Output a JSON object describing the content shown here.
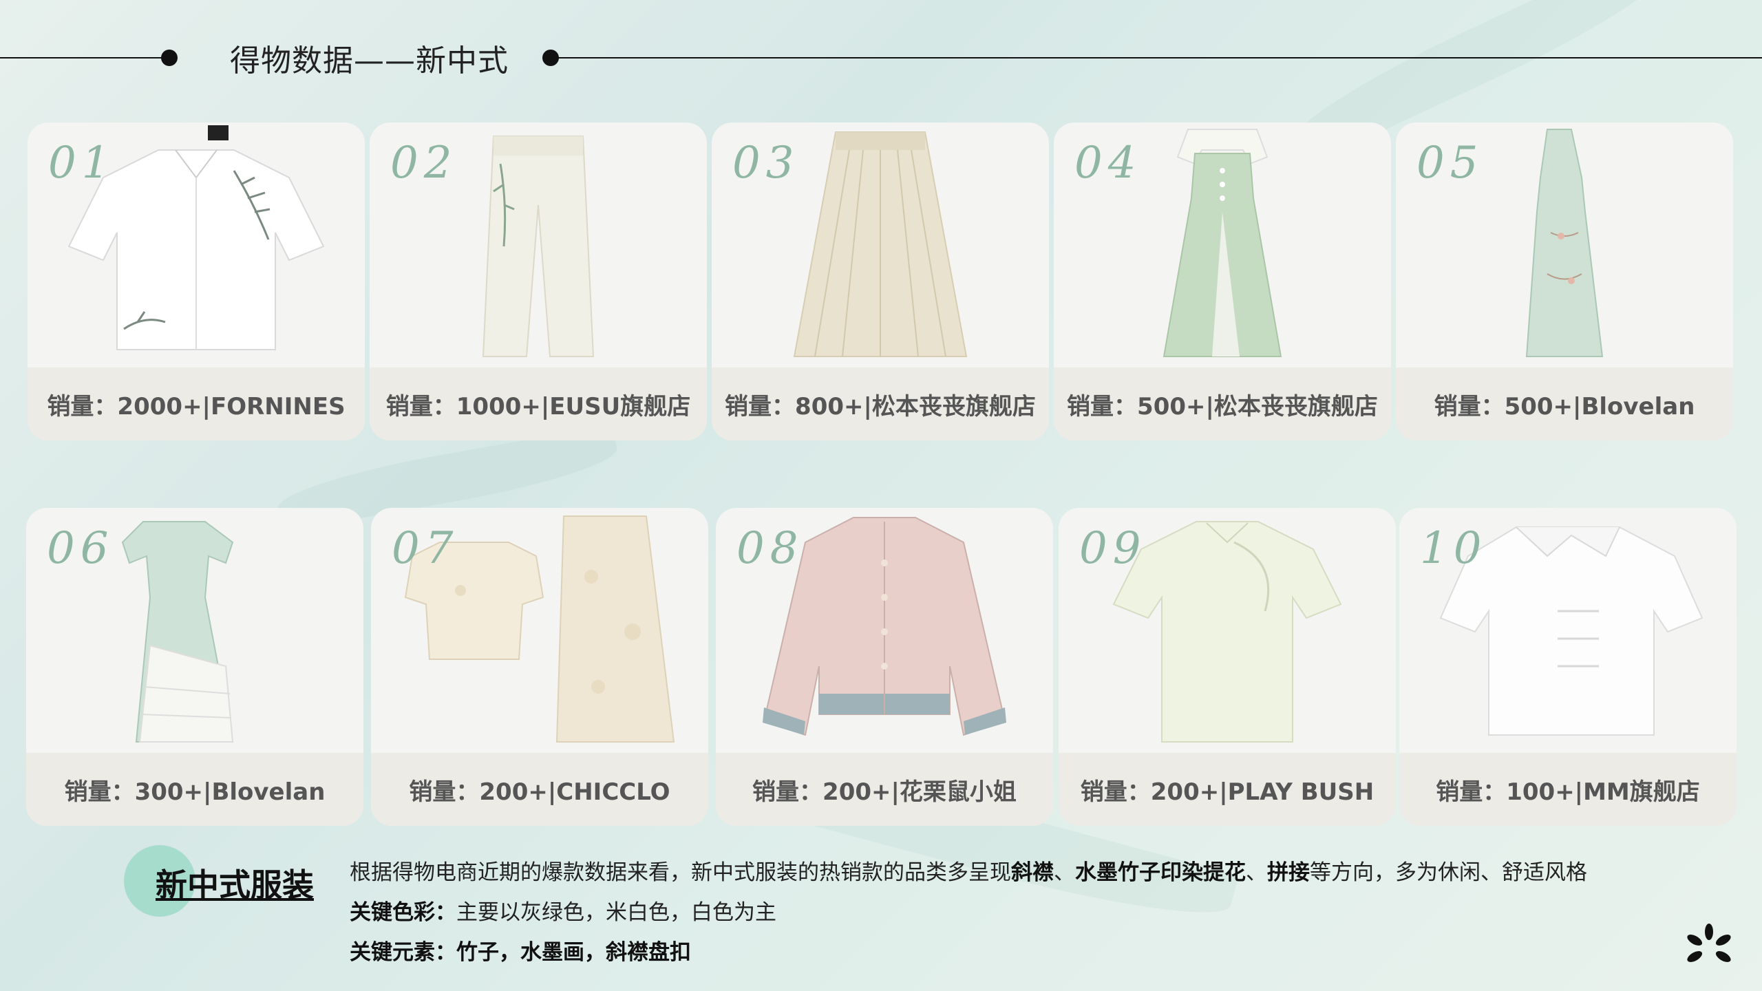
{
  "header": {
    "title": "得物数据——新中式"
  },
  "cards": [
    {
      "num": "01",
      "label": "销量：2000+|FORNINES"
    },
    {
      "num": "02",
      "label": "销量：1000+|EUSU旗舰店"
    },
    {
      "num": "03",
      "label": "销量：800+|松本丧丧旗舰店"
    },
    {
      "num": "04",
      "label": "销量：500+|松本丧丧旗舰店"
    },
    {
      "num": "05",
      "label": "销量：500+|Blovelan"
    },
    {
      "num": "06",
      "label": "销量：300+|Blovelan"
    },
    {
      "num": "07",
      "label": "销量：200+|CHICCLO"
    },
    {
      "num": "08",
      "label": "销量：200+|花栗鼠小姐"
    },
    {
      "num": "09",
      "label": "销量：200+|PLAY BUSH"
    },
    {
      "num": "10",
      "label": "销量：100+|MM旗舰店"
    }
  ],
  "summary": {
    "badge": "新中式服装",
    "line1": {
      "prefix": "根据得物电商近期的爆款数据来看，新中式服装的热销款的品类多呈现",
      "b1": "斜襟",
      "sep1": "、",
      "b2": "水墨竹子印染提花",
      "sep2": "、",
      "b3": "拼接",
      "suffix": "等方向，多为休闲、舒适风格"
    },
    "line2": {
      "label": "关键色彩：",
      "text": "主要以灰绿色，米白色，白色为主"
    },
    "line3": {
      "label": "关键元素：",
      "text": "竹子，水墨画，斜襟盘扣"
    }
  },
  "colors": {
    "accent": "#8fb5a3",
    "badge": "#a6dccc",
    "card_bg": "#f4f4f3",
    "card_footer": "#ecebe5"
  }
}
